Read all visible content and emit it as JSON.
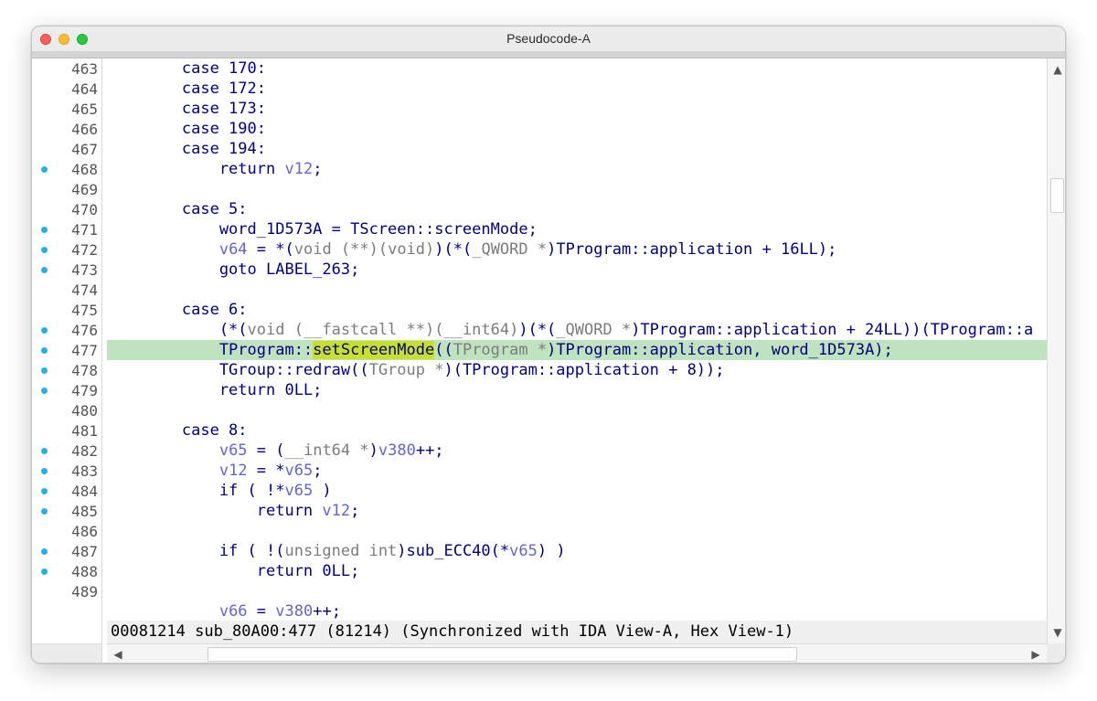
{
  "window": {
    "title": "Pseudocode-A"
  },
  "line_numbers": [
    {
      "n": "463",
      "bp": false
    },
    {
      "n": "464",
      "bp": false
    },
    {
      "n": "465",
      "bp": false
    },
    {
      "n": "466",
      "bp": false
    },
    {
      "n": "467",
      "bp": false
    },
    {
      "n": "468",
      "bp": true
    },
    {
      "n": "469",
      "bp": false
    },
    {
      "n": "470",
      "bp": false
    },
    {
      "n": "471",
      "bp": true
    },
    {
      "n": "472",
      "bp": true
    },
    {
      "n": "473",
      "bp": true
    },
    {
      "n": "474",
      "bp": false
    },
    {
      "n": "475",
      "bp": false
    },
    {
      "n": "476",
      "bp": true
    },
    {
      "n": "477",
      "bp": true
    },
    {
      "n": "478",
      "bp": true
    },
    {
      "n": "479",
      "bp": true
    },
    {
      "n": "480",
      "bp": false
    },
    {
      "n": "481",
      "bp": false
    },
    {
      "n": "482",
      "bp": true
    },
    {
      "n": "483",
      "bp": true
    },
    {
      "n": "484",
      "bp": true
    },
    {
      "n": "485",
      "bp": true
    },
    {
      "n": "486",
      "bp": false
    },
    {
      "n": "487",
      "bp": true
    },
    {
      "n": "488",
      "bp": true
    },
    {
      "n": "489",
      "bp": false
    }
  ],
  "code": {
    "l463": "        case 170:",
    "l464": "        case 172:",
    "l465": "        case 173:",
    "l466": "        case 190:",
    "l467": "        case 194:",
    "l468_a": "            return ",
    "l468_v": "v12",
    "l468_b": ";",
    "l470": "        case 5:",
    "l471": "            word_1D573A = TScreen::screenMode;",
    "l472_v": "v64",
    "l472_a": " = *(",
    "l472_g1": "void (**)(void)",
    "l472_b": ")(*(",
    "l472_g2": "_QWORD *",
    "l472_c": ")TProgram::application + 16LL);",
    "l473": "            goto LABEL_263;",
    "l475": "        case 6:",
    "l476_a": "            (*(",
    "l476_g1": "void (__fastcall **)(__int64)",
    "l476_b": ")(*(",
    "l476_g2": "_QWORD *",
    "l476_c": ")TProgram::application + 24LL))(TProgram::a",
    "l477_a": "            TProgram::",
    "l477_f": "setScreenMode",
    "l477_b": "((",
    "l477_g": "TProgram *",
    "l477_c": ")TProgram::application, word_1D573A);",
    "l478_a": "            TGroup::redraw((",
    "l478_g": "TGroup *",
    "l478_c": ")(TProgram::application + 8));",
    "l479": "            return 0LL;",
    "l481": "        case 8:",
    "l482_v1": "v65",
    "l482_a": " = (",
    "l482_g": "__int64 *",
    "l482_b": ")",
    "l482_v2": "v380",
    "l482_c": "++;",
    "l483_v1": "v12",
    "l483_a": " = *",
    "l483_v2": "v65",
    "l483_b": ";",
    "l484_a": "            if ( !*",
    "l484_v": "v65",
    "l484_b": " )",
    "l485_a": "                return ",
    "l485_v": "v12",
    "l485_b": ";",
    "l487_a": "            if ( !(",
    "l487_g": "unsigned int",
    "l487_b": ")sub_ECC40(*",
    "l487_v": "v65",
    "l487_c": ") )",
    "l488": "                return 0LL;",
    "l490_v1": "v66",
    "l490_a": " = ",
    "l490_v2": "v380",
    "l490_b": "++;"
  },
  "status": "00081214 sub_80A00:477 (81214) (Synchronized with IDA View-A, Hex View-1)",
  "colors": {
    "breakpoint": "#1fb3ea",
    "highlight_line": "#bfe3bf",
    "highlight_word": "#c8e02a",
    "code": "#000080",
    "variable": "#6464d0",
    "type": "#7c7c7c"
  }
}
